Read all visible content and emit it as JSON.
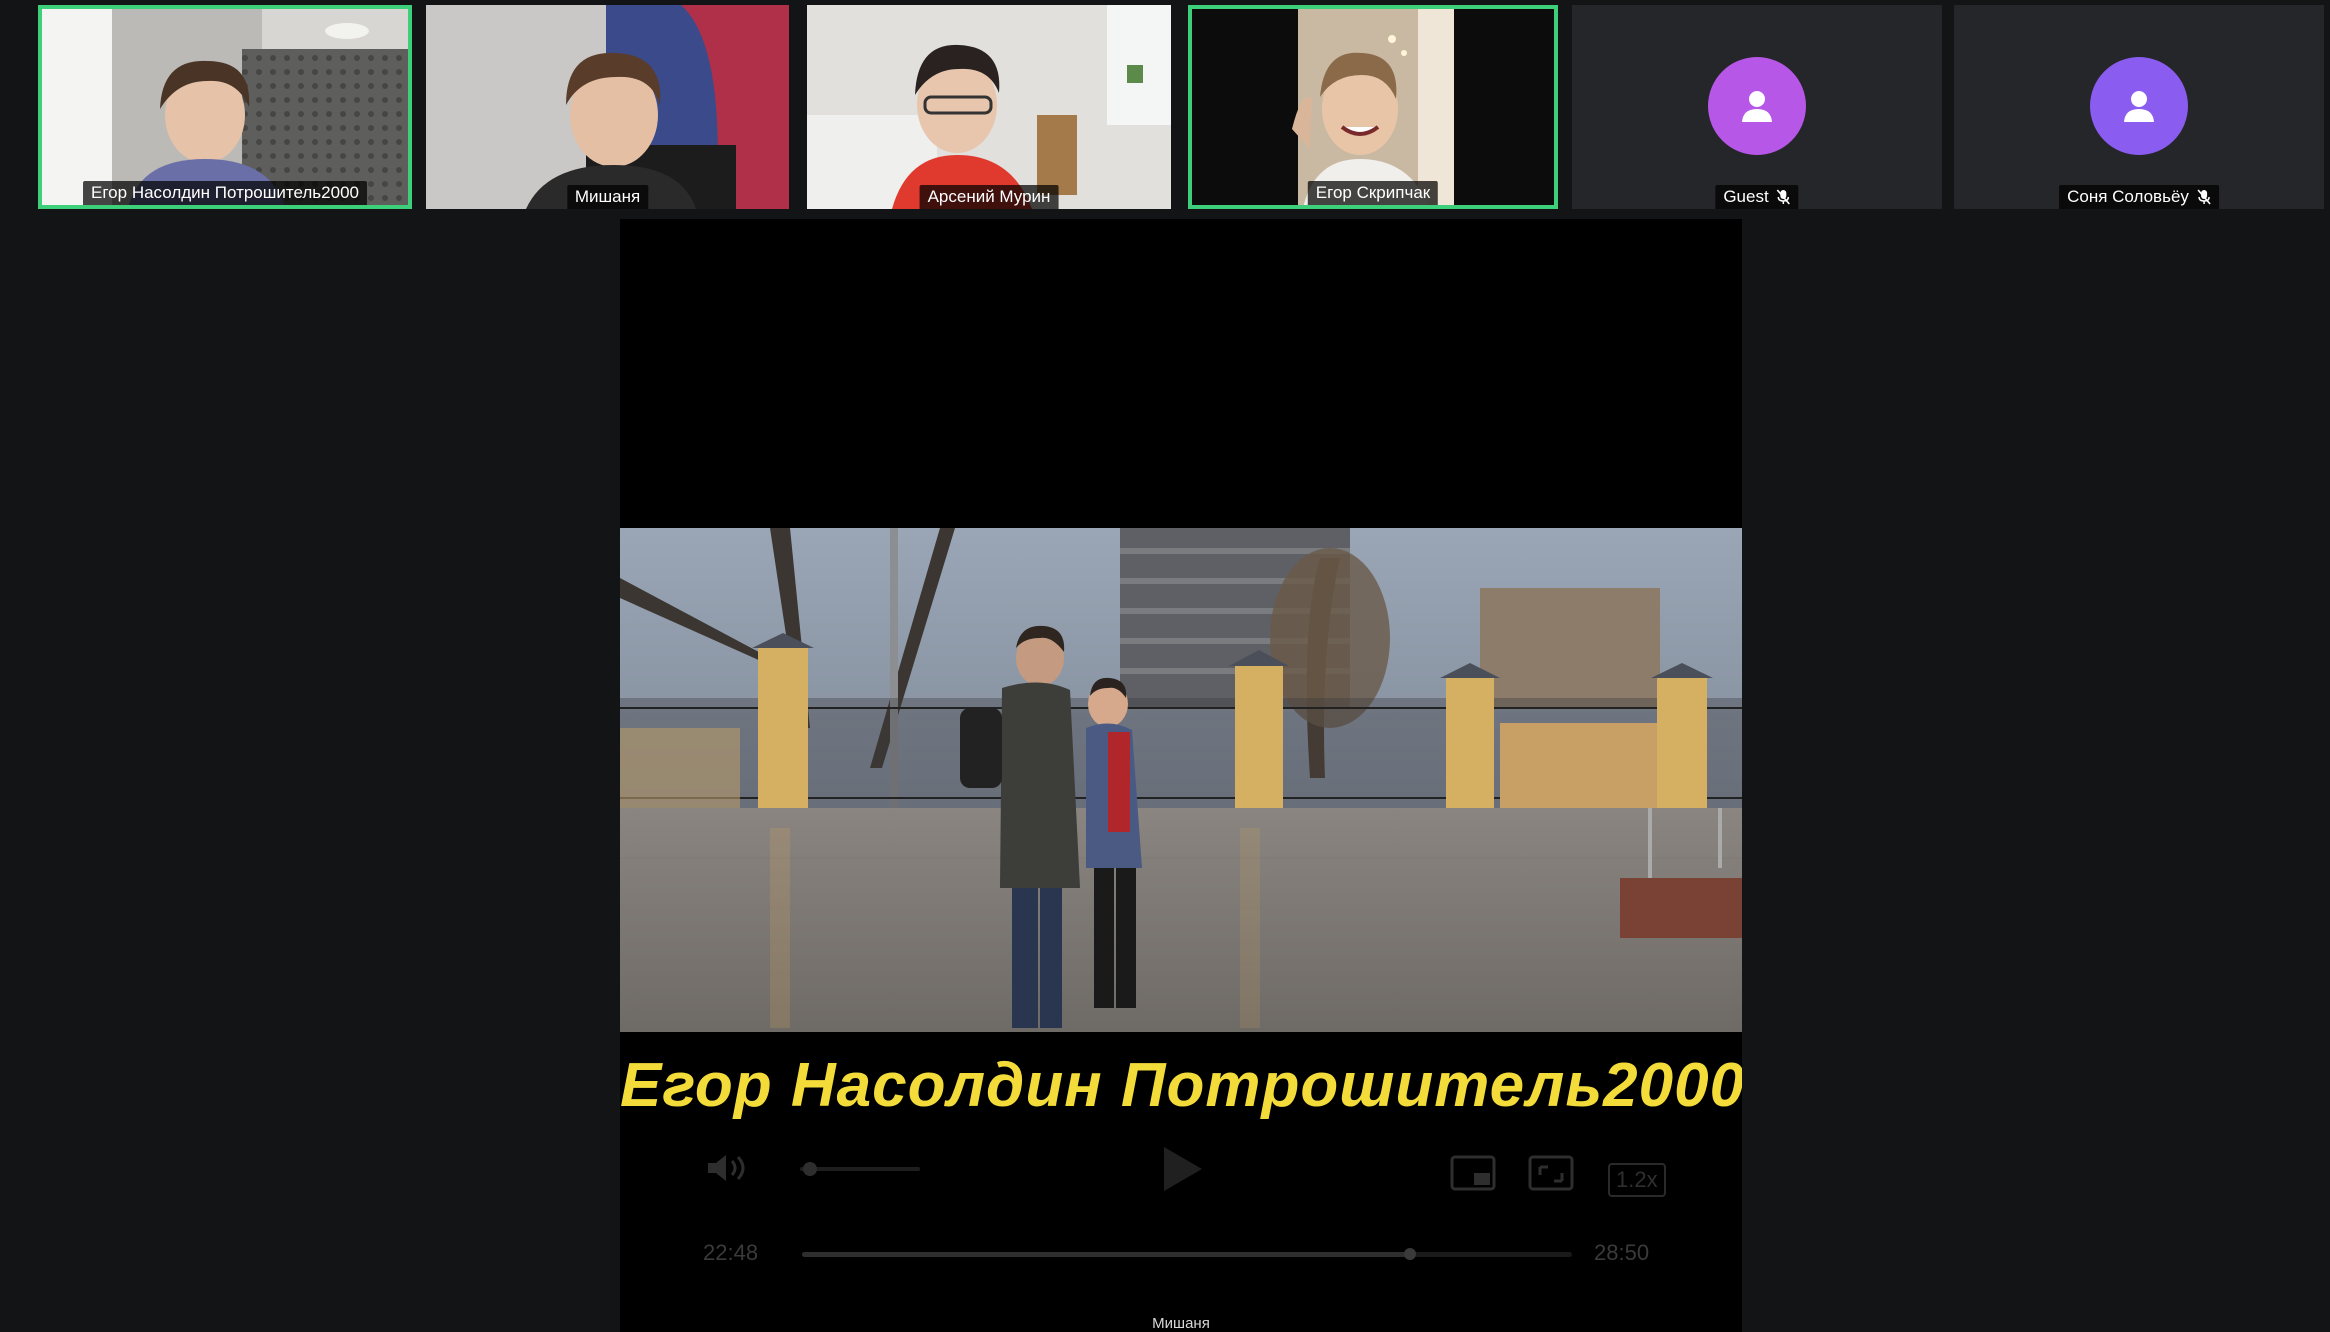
{
  "participants": [
    {
      "name": "Егор Насолдин Потрошитель2000",
      "speaking": true,
      "camera": true
    },
    {
      "name": "Мишаня",
      "speaking": false,
      "camera": true
    },
    {
      "name": "Арсений Мурин",
      "speaking": false,
      "camera": true
    },
    {
      "name": "Егор Скрипчак",
      "speaking": true,
      "camera": true
    },
    {
      "name": "Guest",
      "speaking": false,
      "camera": false,
      "muted": true
    },
    {
      "name": "Соня Соловьёу",
      "speaking": false,
      "camera": false,
      "muted": true
    }
  ],
  "shared_screen": {
    "caption": "Егор Насолдин Потрошитель2000",
    "presenter": "Мишаня",
    "player": {
      "time_elapsed": "22:48",
      "time_total": "28:50",
      "speed": "1.2x",
      "progress": 0.79
    }
  },
  "colors": {
    "background": "#131416",
    "speaking_border": "#3ecf7a",
    "avatar": "#b657e8",
    "avatar_alt": "#8a5cf0",
    "caption": "#f3dc3a"
  }
}
